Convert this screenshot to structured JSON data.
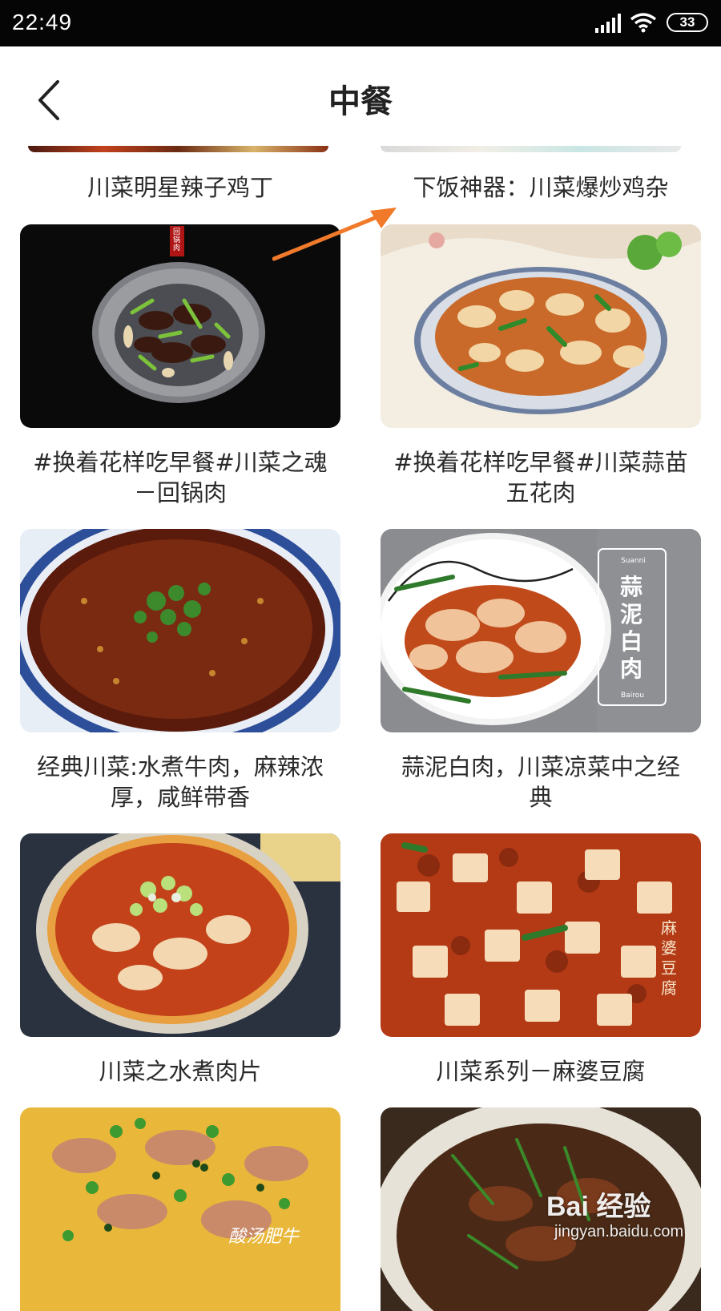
{
  "status_bar": {
    "time": "22:49",
    "battery": "33"
  },
  "header": {
    "title": "中餐"
  },
  "recipes": [
    {
      "title": "川菜明星辣子鸡丁"
    },
    {
      "title": "下饭神器：川菜爆炒鸡杂"
    },
    {
      "title": "#换着花样吃早餐#川菜之魂\n－回锅肉"
    },
    {
      "title": "#换着花样吃早餐#川菜蒜苗\n五花肉"
    },
    {
      "title": "经典川菜:水煮牛肉，麻辣浓\n厚，咸鲜带香"
    },
    {
      "title": "蒜泥白肉，川菜凉菜中之经\n典"
    },
    {
      "title": "川菜之水煮肉片"
    },
    {
      "title": "川菜系列－麻婆豆腐"
    },
    {
      "title": ""
    },
    {
      "title": ""
    }
  ],
  "photo_text": {
    "img_garlic_banner": "蒜\n泥\n白\n肉",
    "img_garlic_top": "Suanni",
    "img_garlic_bottom": "Bairou",
    "img_mapo_side": "麻\n婆\n豆\n腐",
    "img_seal": "回\n锅\n肉",
    "img_sour_soup": "酸汤肥牛"
  },
  "watermark": {
    "logo": "Bai 经验",
    "url": "jingyan.baidu.com"
  },
  "colors": {
    "status_bar_bg": "#050505",
    "annotation_arrow": "#f07a2a"
  }
}
